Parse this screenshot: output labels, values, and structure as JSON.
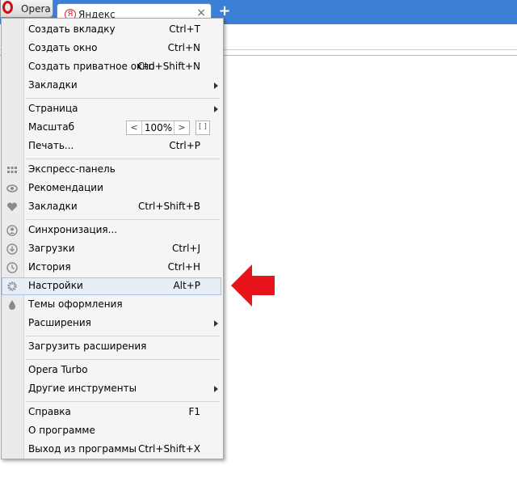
{
  "browser": {
    "opera_button_label": "Opera",
    "tab_title": "Яндекс",
    "tab_favicon": "Я",
    "tab_close": "×",
    "new_tab": "+"
  },
  "menu": {
    "items": [
      {
        "label": "Создать вкладку",
        "shortcut": "Ctrl+T"
      },
      {
        "label": "Создать окно",
        "shortcut": "Ctrl+N"
      },
      {
        "label": "Создать приватное окно",
        "shortcut": "Ctrl+Shift+N"
      },
      {
        "label": "Закладки",
        "shortcut": ""
      },
      {
        "label": "Страница",
        "shortcut": ""
      },
      {
        "label": "Масштаб",
        "shortcut": ""
      },
      {
        "label": "Печать...",
        "shortcut": "Ctrl+P"
      },
      {
        "label": "Экспресс-панель",
        "shortcut": ""
      },
      {
        "label": "Рекомендации",
        "shortcut": ""
      },
      {
        "label": "Закладки",
        "shortcut": "Ctrl+Shift+B"
      },
      {
        "label": "Синхронизация...",
        "shortcut": ""
      },
      {
        "label": "Загрузки",
        "shortcut": "Ctrl+J"
      },
      {
        "label": "История",
        "shortcut": "Ctrl+H"
      },
      {
        "label": "Настройки",
        "shortcut": "Alt+P"
      },
      {
        "label": "Темы оформления",
        "shortcut": ""
      },
      {
        "label": "Расширения",
        "shortcut": ""
      },
      {
        "label": "Загрузить расширения",
        "shortcut": ""
      },
      {
        "label": "Opera Turbo",
        "shortcut": ""
      },
      {
        "label": "Другие инструменты",
        "shortcut": ""
      },
      {
        "label": "Справка",
        "shortcut": "F1"
      },
      {
        "label": "О программе",
        "shortcut": ""
      },
      {
        "label": "Выход из программы",
        "shortcut": "Ctrl+Shift+X"
      }
    ],
    "zoom": {
      "minus": "<",
      "value": "100%",
      "plus": ">",
      "fullscreen": "[ ]"
    }
  },
  "colors": {
    "accent_arrow": "#e8141c",
    "titlebar": "#3c7fd6"
  }
}
